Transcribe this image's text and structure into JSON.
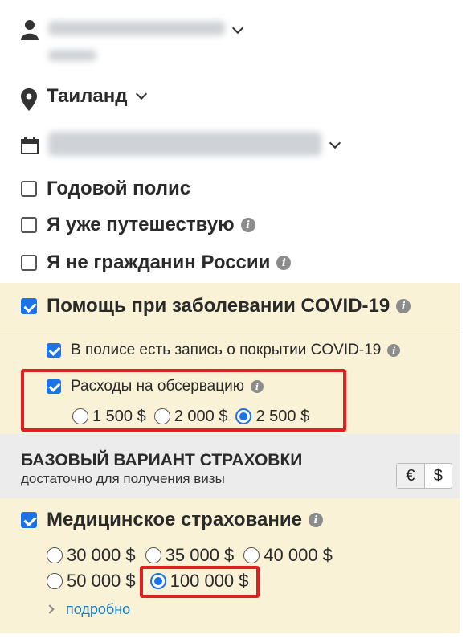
{
  "destination": {
    "country": "Таиланд"
  },
  "options": {
    "annual": "Годовой полис",
    "travelling": "Я уже путешествую",
    "not_citizen": "Я не гражданин России"
  },
  "covid": {
    "title": "Помощь при заболевании COVID-19",
    "record": "В полисе есть запись о покрытии COVID-19",
    "observation": "Расходы на обсервацию",
    "amounts": [
      "1 500 $",
      "2 000 $",
      "2 500 $"
    ]
  },
  "base": {
    "title": "БАЗОВЫЙ ВАРИАНТ СТРАХОВКИ",
    "subtitle": "достаточно для получения визы",
    "currency_eur": "€",
    "currency_usd": "$"
  },
  "medical": {
    "title": "Медицинское страхование",
    "amounts": [
      "30 000 $",
      "35 000 $",
      "40 000 $",
      "50 000 $",
      "100 000 $"
    ],
    "more": "подробно"
  },
  "colors": {
    "accent": "#1b73e8",
    "highlight": "#e02020",
    "band": "#f9f2d6"
  }
}
